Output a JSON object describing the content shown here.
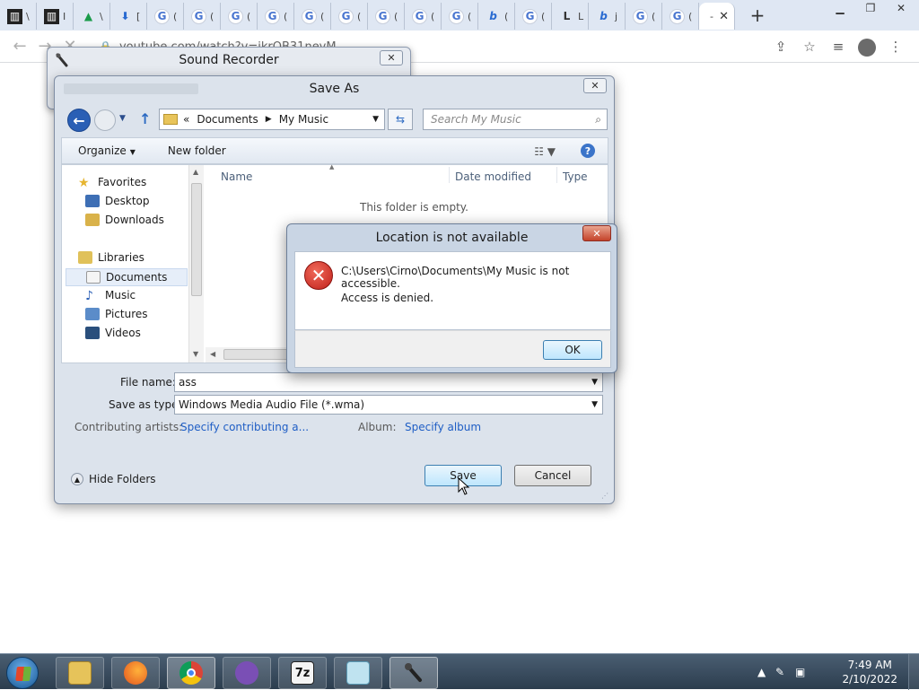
{
  "browser": {
    "tabs": [
      {
        "favicon": "archive-icon",
        "text": "\\"
      },
      {
        "favicon": "archive-icon",
        "text": "I"
      },
      {
        "favicon": "drive-icon",
        "text": "\\"
      },
      {
        "favicon": "download-icon",
        "text": "["
      },
      {
        "favicon": "google-icon",
        "text": "("
      },
      {
        "favicon": "google-icon",
        "text": "("
      },
      {
        "favicon": "google-icon",
        "text": "("
      },
      {
        "favicon": "google-icon",
        "text": "("
      },
      {
        "favicon": "google-icon",
        "text": "("
      },
      {
        "favicon": "google-icon",
        "text": "("
      },
      {
        "favicon": "google-icon",
        "text": "("
      },
      {
        "favicon": "google-icon",
        "text": "("
      },
      {
        "favicon": "google-icon",
        "text": "("
      },
      {
        "favicon": "bing-icon",
        "text": "("
      },
      {
        "favicon": "google-icon",
        "text": "("
      },
      {
        "favicon": "letter-icon",
        "text": "L"
      },
      {
        "favicon": "bing-icon",
        "text": "j"
      },
      {
        "favicon": "google-icon",
        "text": "("
      },
      {
        "favicon": "google-icon",
        "text": "("
      }
    ],
    "active_tab": {
      "text": "-",
      "close": "✕"
    },
    "new_tab": "+",
    "url": "youtube.com/watch?v=ikrQB31neyM"
  },
  "recorder": {
    "title": "Sound Recorder",
    "close": "✕"
  },
  "saveas": {
    "title": "Save As",
    "close": "✕",
    "path": {
      "chevrons": "«",
      "crumb1": "Documents",
      "sep": "▶",
      "crumb2": "My Music"
    },
    "search_placeholder": "Search My Music",
    "organize": "Organize",
    "new_folder": "New folder",
    "nav": {
      "favorites": "Favorites",
      "desktop": "Desktop",
      "downloads": "Downloads",
      "libraries": "Libraries",
      "documents": "Documents",
      "music": "Music",
      "pictures": "Pictures",
      "videos": "Videos"
    },
    "columns": {
      "name": "Name",
      "date_modified": "Date modified",
      "type": "Type"
    },
    "empty_text": "This folder is empty.",
    "file_name_label": "File name:",
    "file_name_value": "ass",
    "save_as_type_label": "Save as type:",
    "save_as_type_value": "Windows Media Audio File (*.wma)",
    "contributing_label": "Contributing artists:",
    "contributing_value": "Specify contributing a...",
    "album_label": "Album:",
    "album_value": "Specify album",
    "hide_folders": "Hide Folders",
    "save_button": "Save",
    "cancel_button": "Cancel"
  },
  "error": {
    "title": "Location is not available",
    "close": "✕",
    "message": "C:\\Users\\Cirno\\Documents\\My Music is not accessible.",
    "detail": "Access is denied.",
    "ok": "OK"
  },
  "taskbar": {
    "apps": [
      "file-explorer",
      "firefox",
      "chrome",
      "bonzi-buddy",
      "7zip",
      "notepad",
      "sound-recorder"
    ],
    "sevenzip_label": "7z",
    "time": "7:49 AM",
    "date": "2/10/2022"
  },
  "colors": {
    "accent": "#2a5fb5",
    "error_red": "#c0201a",
    "link": "#1f5ec5"
  }
}
